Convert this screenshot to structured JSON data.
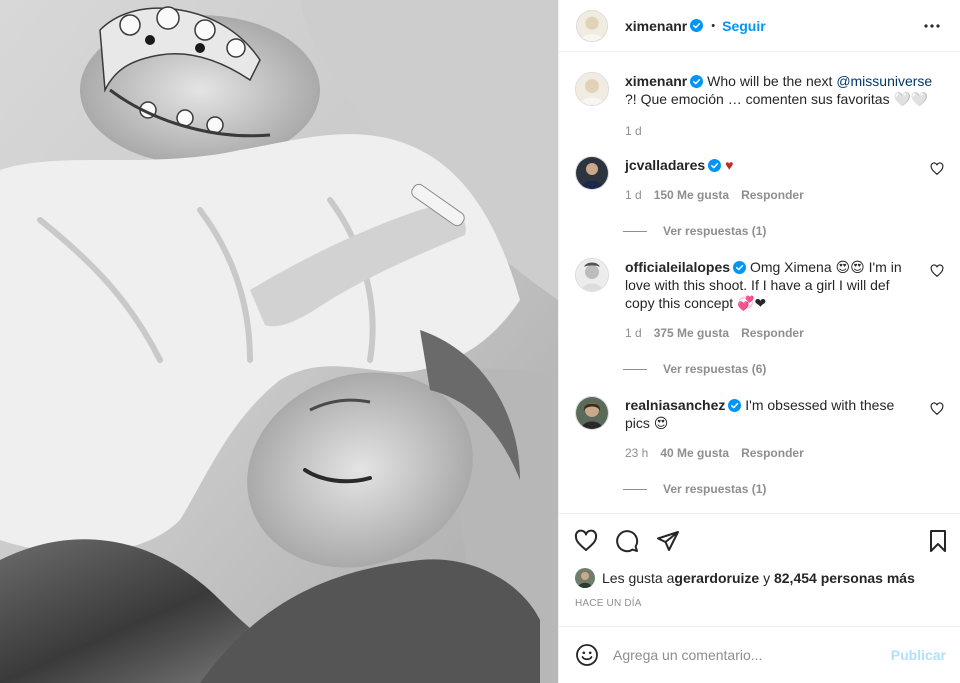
{
  "post": {
    "username": "ximenanr",
    "separator": "•",
    "follow_label": "Seguir",
    "caption": {
      "pre": "Who will be the next ",
      "mention": "@missuniverse",
      "post": " ?! Que emoción … comenten sus favoritas 🤍🤍",
      "age": "1 d"
    },
    "comments": [
      {
        "username": "jcvalladares",
        "text": "♥",
        "age": "1 d",
        "likes": "150 Me gusta",
        "reply_label": "Responder",
        "view_replies": "Ver respuestas (1)"
      },
      {
        "username": "officialeilalopes",
        "text": "Omg Ximena 😍😍 I'm in love with this shoot. If I have a girl I will def copy this concept 💞❤",
        "age": "1 d",
        "likes": "375 Me gusta",
        "reply_label": "Responder",
        "view_replies": "Ver respuestas (6)"
      },
      {
        "username": "realniasanchez",
        "text": "I'm obsessed with these pics 😍",
        "age": "23 h",
        "likes": "40 Me gusta",
        "reply_label": "Responder",
        "view_replies": "Ver respuestas (1)"
      }
    ],
    "likes_line": {
      "pre": "Les gusta a ",
      "user": "gerardoruize",
      "mid": " y ",
      "count": "82,454 personas más"
    },
    "timestamp": "Hace un día",
    "add_comment": {
      "placeholder": "Agrega un comentario...",
      "publish_label": "Publicar"
    }
  },
  "icons": {
    "more": "more-horizontal-icon",
    "like": "heart-icon",
    "comment": "comment-bubble-icon",
    "share": "paper-plane-icon",
    "save": "bookmark-icon",
    "emoji": "emoji-smile-icon",
    "verified": "verified-badge-icon"
  },
  "colors": {
    "link": "#0095f6",
    "mention": "#00376b",
    "verified": "#0095f6",
    "publish_disabled": "#b2dffc",
    "heart_red": "#c62828"
  }
}
